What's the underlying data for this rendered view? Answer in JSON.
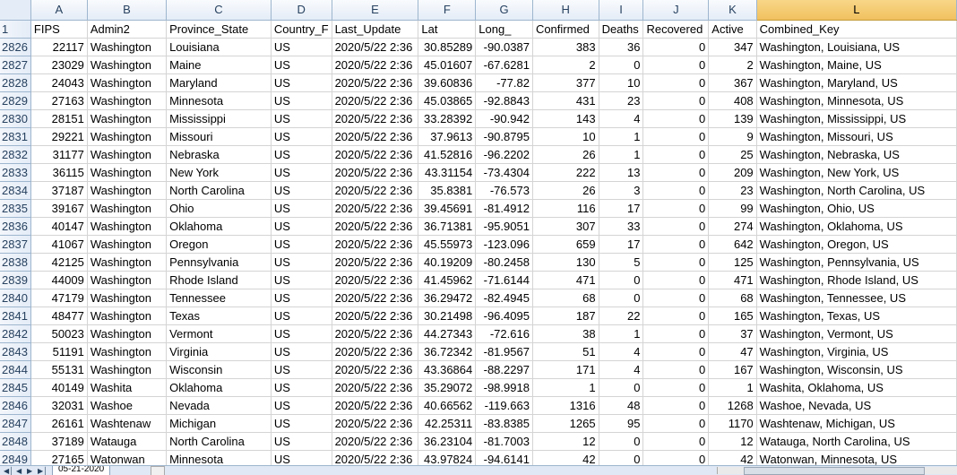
{
  "columns": [
    {
      "letter": "A",
      "header": "FIPS"
    },
    {
      "letter": "B",
      "header": "Admin2"
    },
    {
      "letter": "C",
      "header": "Province_State"
    },
    {
      "letter": "D",
      "header": "Country_F"
    },
    {
      "letter": "E",
      "header": "Last_Update"
    },
    {
      "letter": "F",
      "header": "Lat"
    },
    {
      "letter": "G",
      "header": "Long_"
    },
    {
      "letter": "H",
      "header": "Confirmed"
    },
    {
      "letter": "I",
      "header": "Deaths"
    },
    {
      "letter": "J",
      "header": "Recovered"
    },
    {
      "letter": "K",
      "header": "Active"
    },
    {
      "letter": "L",
      "header": "Combined_Key"
    }
  ],
  "selected_column": "L",
  "header_row_number": "1",
  "rows": [
    {
      "n": "2826",
      "c": [
        "22117",
        "Washington",
        "Louisiana",
        "US",
        "2020/5/22 2:36",
        "30.85289",
        "-90.0387",
        "383",
        "36",
        "0",
        "347",
        "Washington, Louisiana, US"
      ]
    },
    {
      "n": "2827",
      "c": [
        "23029",
        "Washington",
        "Maine",
        "US",
        "2020/5/22 2:36",
        "45.01607",
        "-67.6281",
        "2",
        "0",
        "0",
        "2",
        "Washington, Maine, US"
      ]
    },
    {
      "n": "2828",
      "c": [
        "24043",
        "Washington",
        "Maryland",
        "US",
        "2020/5/22 2:36",
        "39.60836",
        "-77.82",
        "377",
        "10",
        "0",
        "367",
        "Washington, Maryland, US"
      ]
    },
    {
      "n": "2829",
      "c": [
        "27163",
        "Washington",
        "Minnesota",
        "US",
        "2020/5/22 2:36",
        "45.03865",
        "-92.8843",
        "431",
        "23",
        "0",
        "408",
        "Washington, Minnesota, US"
      ]
    },
    {
      "n": "2830",
      "c": [
        "28151",
        "Washington",
        "Mississippi",
        "US",
        "2020/5/22 2:36",
        "33.28392",
        "-90.942",
        "143",
        "4",
        "0",
        "139",
        "Washington, Mississippi, US"
      ]
    },
    {
      "n": "2831",
      "c": [
        "29221",
        "Washington",
        "Missouri",
        "US",
        "2020/5/22 2:36",
        "37.9613",
        "-90.8795",
        "10",
        "1",
        "0",
        "9",
        "Washington, Missouri, US"
      ]
    },
    {
      "n": "2832",
      "c": [
        "31177",
        "Washington",
        "Nebraska",
        "US",
        "2020/5/22 2:36",
        "41.52816",
        "-96.2202",
        "26",
        "1",
        "0",
        "25",
        "Washington, Nebraska, US"
      ]
    },
    {
      "n": "2833",
      "c": [
        "36115",
        "Washington",
        "New York",
        "US",
        "2020/5/22 2:36",
        "43.31154",
        "-73.4304",
        "222",
        "13",
        "0",
        "209",
        "Washington, New York, US"
      ]
    },
    {
      "n": "2834",
      "c": [
        "37187",
        "Washington",
        "North Carolina",
        "US",
        "2020/5/22 2:36",
        "35.8381",
        "-76.573",
        "26",
        "3",
        "0",
        "23",
        "Washington, North Carolina, US"
      ]
    },
    {
      "n": "2835",
      "c": [
        "39167",
        "Washington",
        "Ohio",
        "US",
        "2020/5/22 2:36",
        "39.45691",
        "-81.4912",
        "116",
        "17",
        "0",
        "99",
        "Washington, Ohio, US"
      ]
    },
    {
      "n": "2836",
      "c": [
        "40147",
        "Washington",
        "Oklahoma",
        "US",
        "2020/5/22 2:36",
        "36.71381",
        "-95.9051",
        "307",
        "33",
        "0",
        "274",
        "Washington, Oklahoma, US"
      ]
    },
    {
      "n": "2837",
      "c": [
        "41067",
        "Washington",
        "Oregon",
        "US",
        "2020/5/22 2:36",
        "45.55973",
        "-123.096",
        "659",
        "17",
        "0",
        "642",
        "Washington, Oregon, US"
      ]
    },
    {
      "n": "2838",
      "c": [
        "42125",
        "Washington",
        "Pennsylvania",
        "US",
        "2020/5/22 2:36",
        "40.19209",
        "-80.2458",
        "130",
        "5",
        "0",
        "125",
        "Washington, Pennsylvania, US"
      ]
    },
    {
      "n": "2839",
      "c": [
        "44009",
        "Washington",
        "Rhode Island",
        "US",
        "2020/5/22 2:36",
        "41.45962",
        "-71.6144",
        "471",
        "0",
        "0",
        "471",
        "Washington, Rhode Island, US"
      ]
    },
    {
      "n": "2840",
      "c": [
        "47179",
        "Washington",
        "Tennessee",
        "US",
        "2020/5/22 2:36",
        "36.29472",
        "-82.4945",
        "68",
        "0",
        "0",
        "68",
        "Washington, Tennessee, US"
      ]
    },
    {
      "n": "2841",
      "c": [
        "48477",
        "Washington",
        "Texas",
        "US",
        "2020/5/22 2:36",
        "30.21498",
        "-96.4095",
        "187",
        "22",
        "0",
        "165",
        "Washington, Texas, US"
      ]
    },
    {
      "n": "2842",
      "c": [
        "50023",
        "Washington",
        "Vermont",
        "US",
        "2020/5/22 2:36",
        "44.27343",
        "-72.616",
        "38",
        "1",
        "0",
        "37",
        "Washington, Vermont, US"
      ]
    },
    {
      "n": "2843",
      "c": [
        "51191",
        "Washington",
        "Virginia",
        "US",
        "2020/5/22 2:36",
        "36.72342",
        "-81.9567",
        "51",
        "4",
        "0",
        "47",
        "Washington, Virginia, US"
      ]
    },
    {
      "n": "2844",
      "c": [
        "55131",
        "Washington",
        "Wisconsin",
        "US",
        "2020/5/22 2:36",
        "43.36864",
        "-88.2297",
        "171",
        "4",
        "0",
        "167",
        "Washington, Wisconsin, US"
      ]
    },
    {
      "n": "2845",
      "c": [
        "40149",
        "Washita",
        "Oklahoma",
        "US",
        "2020/5/22 2:36",
        "35.29072",
        "-98.9918",
        "1",
        "0",
        "0",
        "1",
        "Washita, Oklahoma, US"
      ]
    },
    {
      "n": "2846",
      "c": [
        "32031",
        "Washoe",
        "Nevada",
        "US",
        "2020/5/22 2:36",
        "40.66562",
        "-119.663",
        "1316",
        "48",
        "0",
        "1268",
        "Washoe, Nevada, US"
      ]
    },
    {
      "n": "2847",
      "c": [
        "26161",
        "Washtenaw",
        "Michigan",
        "US",
        "2020/5/22 2:36",
        "42.25311",
        "-83.8385",
        "1265",
        "95",
        "0",
        "1170",
        "Washtenaw, Michigan, US"
      ]
    },
    {
      "n": "2848",
      "c": [
        "37189",
        "Watauga",
        "North Carolina",
        "US",
        "2020/5/22 2:36",
        "36.23104",
        "-81.7003",
        "12",
        "0",
        "0",
        "12",
        "Watauga, North Carolina, US"
      ]
    },
    {
      "n": "2849",
      "c": [
        "27165",
        "Watonwan",
        "Minnesota",
        "US",
        "2020/5/22 2:36",
        "43.97824",
        "-94.6141",
        "42",
        "0",
        "0",
        "42",
        "Watonwan, Minnesota, US"
      ]
    }
  ],
  "sheet_tab": "05-21-2020",
  "colors": {
    "header_bg": "#e4ecf7",
    "selected_header": "#f1c15f",
    "gridline": "#d4d4d4"
  }
}
